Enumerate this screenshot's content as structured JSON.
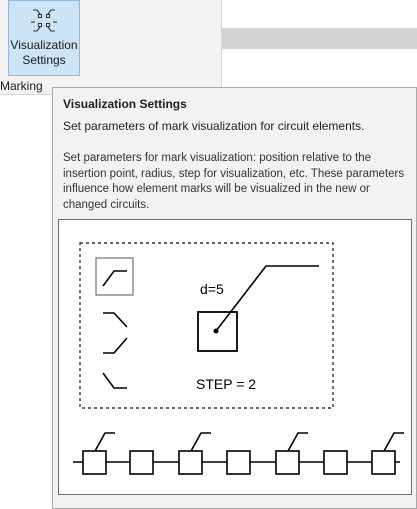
{
  "ribbon": {
    "button_label": "Visualization\nSettings",
    "button_icon": "mark-visualization-icon",
    "group_label": "Marking"
  },
  "tooltip": {
    "title": "Visualization Settings",
    "summary": "Set parameters of mark visualization for circuit elements.",
    "description": "Set parameters for mark visualization: position relative to the insertion point, radius, step for visualization, etc. These parameters influence how element marks will be visualized in the new or changed circuits.",
    "illustration": {
      "radius_label": "d=5",
      "step_label": "STEP = 2"
    }
  },
  "colors": {
    "ribbon_bg": "#f3f3f3",
    "button_selected_bg": "#cde4f7",
    "tooltip_bg": "#f2f2f2"
  }
}
